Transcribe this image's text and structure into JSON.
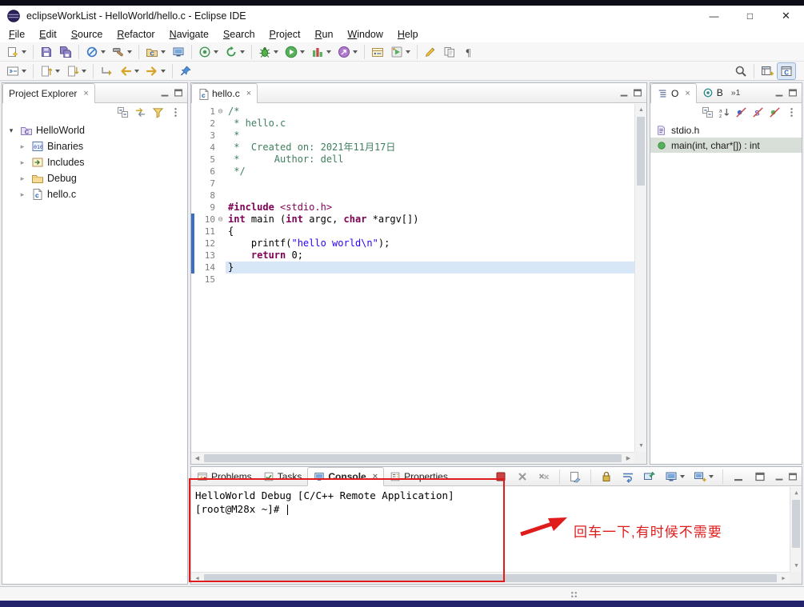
{
  "window": {
    "title": "eclipseWorkList - HelloWorld/hello.c - Eclipse IDE",
    "minimize": "—",
    "maximize": "□",
    "close": "✕"
  },
  "menubar": [
    "File",
    "Edit",
    "Source",
    "Refactor",
    "Navigate",
    "Search",
    "Project",
    "Run",
    "Window",
    "Help"
  ],
  "toolbar1": [
    {
      "name": "new-wizard",
      "icon": "new",
      "dropdown": true
    },
    {
      "sep": true
    },
    {
      "name": "save",
      "icon": "save"
    },
    {
      "name": "save-all",
      "icon": "save-all"
    },
    {
      "sep": true
    },
    {
      "name": "skip-all-breakpoints",
      "icon": "skip",
      "dropdown": true
    },
    {
      "name": "build-all",
      "icon": "hammer",
      "dropdown": true
    },
    {
      "sep": true
    },
    {
      "name": "new-cpp-project",
      "icon": "newproj",
      "dropdown": true
    },
    {
      "name": "show-console-view",
      "icon": "monitor"
    },
    {
      "sep": true
    },
    {
      "name": "launch-debug-config",
      "icon": "target",
      "dropdown": true
    },
    {
      "name": "restart",
      "icon": "restart",
      "dropdown": true
    },
    {
      "sep": true
    },
    {
      "name": "debug",
      "icon": "bug",
      "dropdown": true
    },
    {
      "name": "run",
      "icon": "run",
      "dropdown": true
    },
    {
      "name": "coverage",
      "icon": "coverage",
      "dropdown": true
    },
    {
      "name": "profile",
      "icon": "profile",
      "dropdown": true
    },
    {
      "sep": true
    },
    {
      "name": "open-element",
      "icon": "openelem"
    },
    {
      "name": "external-tools",
      "icon": "exttools",
      "dropdown": true
    },
    {
      "sep": true
    },
    {
      "name": "toggle-mark-occurrences",
      "icon": "pencil"
    },
    {
      "name": "toggle-block-selection",
      "icon": "pages"
    },
    {
      "name": "show-whitespace",
      "icon": "pilcrow"
    }
  ],
  "toolbar2_left": [
    {
      "name": "toggle-breadcrumb",
      "icon": "breadcrumb",
      "dropdown": true
    },
    {
      "sep": true
    },
    {
      "name": "previous-annotation",
      "icon": "prev-ann",
      "dropdown": true
    },
    {
      "name": "next-annotation",
      "icon": "next-ann",
      "dropdown": true
    },
    {
      "sep": true
    },
    {
      "name": "last-edit-location",
      "icon": "last-edit"
    },
    {
      "name": "back-history",
      "icon": "arrow-left",
      "dropdown": true
    },
    {
      "name": "forward-history",
      "icon": "arrow-right",
      "dropdown": true
    },
    {
      "sep": true
    },
    {
      "name": "pin-editor",
      "icon": "pin"
    }
  ],
  "toolbar2_right": [
    {
      "name": "search",
      "icon": "magnifier"
    },
    {
      "sep": true
    },
    {
      "name": "open-perspective",
      "icon": "persp-new"
    },
    {
      "name": "cpp-perspective",
      "icon": "persp-cpp",
      "active": true
    }
  ],
  "project_explorer": {
    "title": "Project Explorer",
    "close": "×",
    "toolbar": [
      {
        "name": "collapse-all",
        "icon": "collapse-all"
      },
      {
        "name": "link-with-editor",
        "icon": "link"
      },
      {
        "name": "filters",
        "icon": "funnel"
      },
      {
        "name": "view-menu",
        "icon": "dots-menu"
      }
    ],
    "tree": [
      {
        "label": "HelloWorld",
        "icon": "c-project",
        "level": 0,
        "expanded": true
      },
      {
        "label": "Binaries",
        "icon": "binaries",
        "level": 1
      },
      {
        "label": "Includes",
        "icon": "includes",
        "level": 1
      },
      {
        "label": "Debug",
        "icon": "folder",
        "level": 1
      },
      {
        "label": "hello.c",
        "icon": "c-file",
        "level": 1
      }
    ]
  },
  "editor": {
    "tab_label": "hello.c",
    "tab_icon": "c-file",
    "close": "×",
    "fold_glyph": "⊖",
    "lines": [
      {
        "n": 1,
        "fold": true,
        "segs": [
          {
            "t": "/*",
            "c": "comment"
          }
        ]
      },
      {
        "n": 2,
        "segs": [
          {
            "t": " * hello.c",
            "c": "comment"
          }
        ]
      },
      {
        "n": 3,
        "segs": [
          {
            "t": " *",
            "c": "comment"
          }
        ]
      },
      {
        "n": 4,
        "segs": [
          {
            "t": " *  Created on: 2021年11月17日",
            "c": "comment"
          }
        ]
      },
      {
        "n": 5,
        "segs": [
          {
            "t": " *      Author: dell",
            "c": "comment"
          }
        ]
      },
      {
        "n": 6,
        "segs": [
          {
            "t": " */",
            "c": "comment"
          }
        ]
      },
      {
        "n": 7,
        "segs": []
      },
      {
        "n": 8,
        "segs": []
      },
      {
        "n": 9,
        "segs": [
          {
            "t": "#include",
            "c": "directive"
          },
          {
            "t": " ",
            "c": "plain"
          },
          {
            "t": "<stdio.h>",
            "c": "directive2"
          }
        ]
      },
      {
        "n": 10,
        "fold": true,
        "changed": true,
        "segs": [
          {
            "t": "int",
            "c": "keyword"
          },
          {
            "t": " ",
            "c": "plain"
          },
          {
            "t": "main",
            "c": "plain"
          },
          {
            "t": " (",
            "c": "plain"
          },
          {
            "t": "int",
            "c": "keyword"
          },
          {
            "t": " argc, ",
            "c": "plain"
          },
          {
            "t": "char",
            "c": "keyword"
          },
          {
            "t": " *argv[])",
            "c": "plain"
          }
        ]
      },
      {
        "n": 11,
        "changed": true,
        "segs": [
          {
            "t": "{",
            "c": "plain"
          }
        ]
      },
      {
        "n": 12,
        "changed": true,
        "segs": [
          {
            "t": "    printf(",
            "c": "plain"
          },
          {
            "t": "\"hello world\\n\"",
            "c": "string"
          },
          {
            "t": ");",
            "c": "plain"
          }
        ]
      },
      {
        "n": 13,
        "changed": true,
        "segs": [
          {
            "t": "    ",
            "c": "plain"
          },
          {
            "t": "return",
            "c": "keyword"
          },
          {
            "t": " 0;",
            "c": "plain"
          }
        ]
      },
      {
        "n": 14,
        "changed": true,
        "current": true,
        "segs": [
          {
            "t": "}",
            "c": "plain"
          }
        ]
      },
      {
        "n": 15,
        "segs": []
      }
    ]
  },
  "outline": {
    "tabs": [
      {
        "label": "O",
        "icon": "outline",
        "close": "×",
        "active": true
      },
      {
        "label": "B",
        "icon": "build-targets"
      }
    ],
    "overflow": "»1",
    "toolbar": [
      {
        "name": "collapse-all",
        "icon": "collapse-all"
      },
      {
        "name": "sort",
        "icon": "sort"
      },
      {
        "name": "hide-fields",
        "icon": "hide-fields"
      },
      {
        "name": "hide-static-members",
        "icon": "hide-static"
      },
      {
        "name": "hide-non-public-members",
        "icon": "hide-non-public"
      },
      {
        "name": "view-menu",
        "icon": "dots-menu"
      }
    ],
    "items": [
      {
        "label": "stdio.h",
        "icon": "include-decl"
      },
      {
        "label": "main(int, char*[]) : int",
        "icon": "function-public",
        "selected": true
      }
    ]
  },
  "bottom_panel": {
    "tabs": [
      {
        "label": "Problems",
        "icon": "problems"
      },
      {
        "label": "Tasks",
        "icon": "tasks"
      },
      {
        "label": "Console",
        "icon": "monitor",
        "close": "×",
        "active": true
      },
      {
        "label": "Properties",
        "icon": "properties"
      }
    ],
    "toolbar": [
      {
        "name": "terminate",
        "icon": "terminate"
      },
      {
        "name": "remove-launch",
        "icon": "gray-x"
      },
      {
        "name": "remove-all-launches",
        "icon": "gray-xx"
      },
      {
        "sep": true
      },
      {
        "name": "clear-console",
        "icon": "clear"
      },
      {
        "sep": true
      },
      {
        "name": "scroll-lock",
        "icon": "scroll-lock"
      },
      {
        "name": "word-wrap",
        "icon": "wordwrap"
      },
      {
        "name": "pin-console",
        "icon": "pin-console"
      },
      {
        "name": "display-selected-console",
        "icon": "monitor",
        "dropdown": true
      },
      {
        "name": "open-console",
        "icon": "open-console",
        "dropdown": true
      },
      {
        "sep": true
      },
      {
        "name": "minimize-view",
        "icon": "min-view"
      },
      {
        "name": "maximize-view",
        "icon": "max-view"
      }
    ],
    "console_title": "HelloWorld Debug [C/C++ Remote Application]",
    "console_prompt": "[root@M28x ~]# "
  },
  "annotation": {
    "text": "回车一下,有时候不需要",
    "color": "#e01b1b"
  },
  "colors": {
    "keyword": "#7F0055",
    "comment": "#3F7F5F",
    "string": "#2A00FF",
    "current_line": "#d7e7f8",
    "change_bar": "#3b6fc4",
    "annotation": "#e01b1b"
  }
}
